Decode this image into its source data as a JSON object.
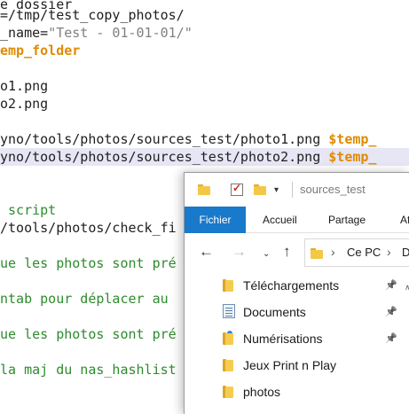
{
  "editor": {
    "lines": [
      [
        {
          "t": "e dossier",
          "c": "plain"
        }
      ],
      [
        {
          "t": "=/tmp/test_copy_photos/",
          "c": "plain"
        }
      ],
      [
        {
          "t": "_name=",
          "c": "plain"
        },
        {
          "t": "\"Test - 01-01-01/\"",
          "c": "str"
        }
      ],
      [
        {
          "t": "emp_folder",
          "c": "var"
        }
      ],
      [],
      [
        {
          "t": "o1.png",
          "c": "plain"
        }
      ],
      [
        {
          "t": "o2.png",
          "c": "plain"
        }
      ],
      [],
      [
        {
          "t": "yno/tools/photos/sources_test/photo1.png ",
          "c": "plain"
        },
        {
          "t": "$temp_",
          "c": "var"
        }
      ],
      [
        {
          "t": "yno/tools/photos/sources_test/photo2.png ",
          "c": "plain"
        },
        {
          "t": "$temp_",
          "c": "var"
        }
      ],
      [],
      [
        {
          "t": " script",
          "c": "comment"
        }
      ],
      [
        {
          "t": "/tools/photos/check_fi",
          "c": "plain"
        }
      ],
      [],
      [
        {
          "t": "ue les photos sont pré",
          "c": "comment"
        }
      ],
      [],
      [
        {
          "t": "ntab pour déplacer au",
          "c": "comment"
        }
      ],
      [],
      [
        {
          "t": "ue les photos sont pré",
          "c": "comment"
        }
      ],
      [],
      [
        {
          "t": "la maj du nas_hashlist",
          "c": "comment"
        }
      ]
    ]
  },
  "explorer": {
    "title": "sources_test",
    "ribbon_tabs": [
      "Fichier",
      "Accueil",
      "Partage",
      "Af"
    ],
    "address": {
      "segments": [
        "Ce PC",
        "D"
      ]
    },
    "tree": [
      {
        "label": "Téléchargements",
        "icon": "folder-icon",
        "pinned": true
      },
      {
        "label": "Documents",
        "icon": "document-icon",
        "pinned": true
      },
      {
        "label": "Numérisations",
        "icon": "scan-folder-icon",
        "pinned": true
      },
      {
        "label": "Jeux Print n Play",
        "icon": "folder-icon",
        "pinned": false
      },
      {
        "label": "photos",
        "icon": "folder-icon",
        "pinned": false
      }
    ]
  }
}
